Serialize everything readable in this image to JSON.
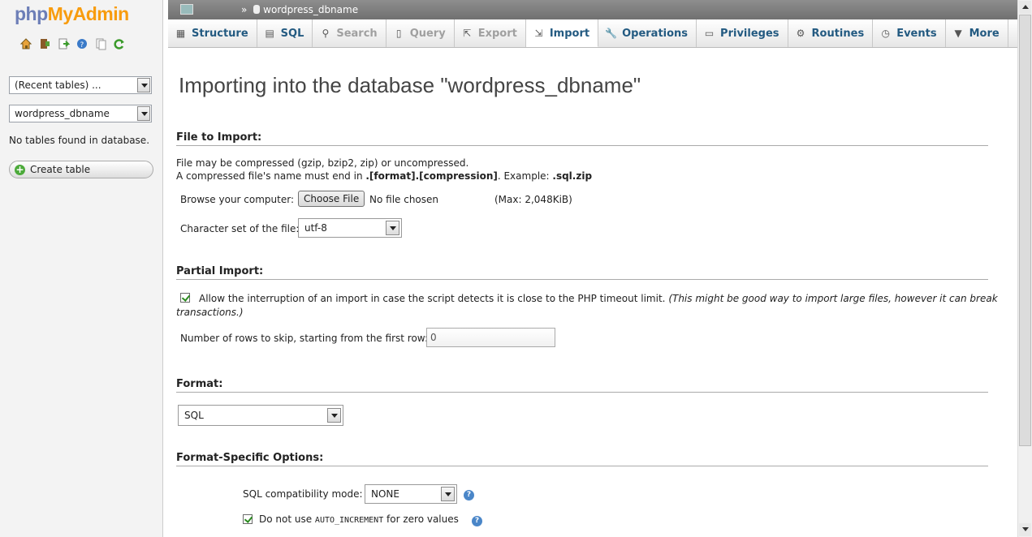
{
  "logo": {
    "part1": "php",
    "part2": "MyAdmin"
  },
  "nav": {
    "icons": [
      "home-icon",
      "logout-icon",
      "query-icon",
      "help-icon",
      "docs-icon",
      "reload-icon"
    ],
    "recent_select": "(Recent tables) ...",
    "db_select": "wordpress_dbname",
    "no_tables": "No tables found in database.",
    "create_table": "Create table"
  },
  "topbar": {
    "breadcrumb": "wordpress_dbname"
  },
  "tabs": [
    {
      "label": "Structure",
      "icon": "structure-icon",
      "state": "normal"
    },
    {
      "label": "SQL",
      "icon": "sql-icon",
      "state": "normal"
    },
    {
      "label": "Search",
      "icon": "search-icon",
      "state": "disabled"
    },
    {
      "label": "Query",
      "icon": "query-icon",
      "state": "disabled"
    },
    {
      "label": "Export",
      "icon": "export-icon",
      "state": "disabled"
    },
    {
      "label": "Import",
      "icon": "import-icon",
      "state": "active"
    },
    {
      "label": "Operations",
      "icon": "wrench-icon",
      "state": "normal"
    },
    {
      "label": "Privileges",
      "icon": "privileges-icon",
      "state": "normal"
    },
    {
      "label": "Routines",
      "icon": "routines-icon",
      "state": "normal"
    },
    {
      "label": "Events",
      "icon": "events-icon",
      "state": "normal"
    },
    {
      "label": "More",
      "icon": "chevron-down-icon",
      "state": "normal"
    }
  ],
  "main": {
    "title": "Importing into the database \"wordpress_dbname\"",
    "file_section": {
      "heading": "File to Import:",
      "line1": "File may be compressed (gzip, bzip2, zip) or uncompressed.",
      "line2_prefix": "A compressed file's name must end in ",
      "line2_bold": ".[format].[compression]",
      "line2_mid": ". Example: ",
      "line2_example": ".sql.zip",
      "browse_label": "Browse your computer:",
      "choose_button": "Choose File",
      "no_file": "No file chosen",
      "max": "(Max: 2,048KiB)",
      "charset_label": "Character set of the file:",
      "charset_value": "utf-8"
    },
    "partial_section": {
      "heading": "Partial Import:",
      "allow_text": "Allow the interruption of an import in case the script detects it is close to the PHP timeout limit.",
      "allow_note_line1": "(This might be good way to import large files, however it can break",
      "allow_note_line2": "transactions.)",
      "skip_label": "Number of rows to skip, starting from the first row:",
      "skip_value": "0"
    },
    "format_section": {
      "heading": "Format:",
      "value": "SQL"
    },
    "format_options": {
      "heading": "Format-Specific Options:",
      "compat_label": "SQL compatibility mode:",
      "compat_value": "NONE",
      "auto_inc_prefix": "Do not use ",
      "auto_inc_code": "AUTO_INCREMENT",
      "auto_inc_suffix": " for zero values"
    }
  }
}
